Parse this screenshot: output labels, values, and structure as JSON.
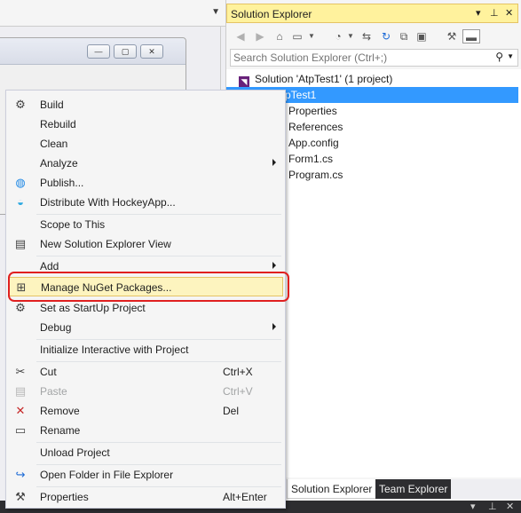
{
  "solution_explorer": {
    "title": "Solution Explorer",
    "pin_controls": [
      "▾",
      "⊥",
      "✕"
    ],
    "search_placeholder": "Search Solution Explorer (Ctrl+;)",
    "tree": [
      {
        "label": "Solution 'AtpTest1' (1 project)"
      },
      {
        "label": "pTest1",
        "selected": true
      },
      {
        "label": "Properties"
      },
      {
        "label": "References"
      },
      {
        "label": "App.config"
      },
      {
        "label": "Form1.cs"
      },
      {
        "label": "Program.cs"
      }
    ],
    "tabs": [
      "Solution Explorer",
      "Team Explorer"
    ]
  },
  "context_menu": {
    "items": [
      {
        "label": "Build",
        "icon": "build-icon"
      },
      {
        "label": "Rebuild"
      },
      {
        "label": "Clean"
      },
      {
        "label": "Analyze",
        "submenu": true
      },
      {
        "label": "Publish...",
        "icon": "globe-icon"
      },
      {
        "label": "Distribute With HockeyApp...",
        "icon": "hockeyapp-icon"
      },
      {
        "label": "Scope to This"
      },
      {
        "label": "New Solution Explorer View",
        "icon": "new-view-icon"
      },
      {
        "label": "Add",
        "submenu": true
      },
      {
        "label": "Manage NuGet Packages...",
        "icon": "nuget-icon",
        "highlighted": true
      },
      {
        "label": "Set as StartUp Project",
        "icon": "gear-icon"
      },
      {
        "label": "Debug",
        "submenu": true
      },
      {
        "label": "Initialize Interactive with Project"
      },
      {
        "label": "Cut",
        "shortcut": "Ctrl+X",
        "icon": "scissors-icon"
      },
      {
        "label": "Paste",
        "shortcut": "Ctrl+V",
        "icon": "paste-icon",
        "disabled": true
      },
      {
        "label": "Remove",
        "shortcut": "Del",
        "icon": "remove-icon"
      },
      {
        "label": "Rename",
        "icon": "rename-icon"
      },
      {
        "label": "Unload Project"
      },
      {
        "label": "Open Folder in File Explorer",
        "icon": "open-folder-icon"
      },
      {
        "label": "Properties",
        "shortcut": "Alt+Enter",
        "icon": "wrench-icon"
      }
    ]
  },
  "colors": {
    "highlight_ring": "#e02020",
    "selection": "#3399ff",
    "title_bar": "#fff29d"
  }
}
